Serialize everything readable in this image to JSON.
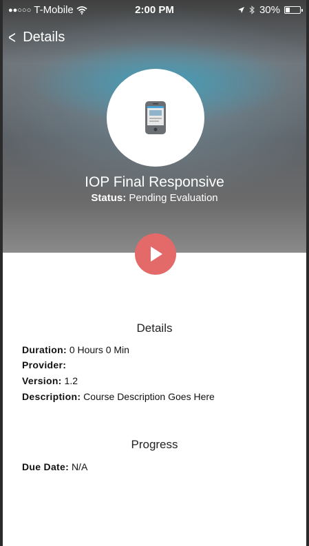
{
  "status_bar": {
    "signal": "●●○○○",
    "carrier": "T-Mobile",
    "time": "2:00 PM",
    "battery": "30%",
    "battery_level": 0.3
  },
  "nav": {
    "back_icon": "chevron-left",
    "title": "Details"
  },
  "course": {
    "icon": "mobile-phone-icon",
    "title": "IOP Final Responsive",
    "status_label": "Status:",
    "status_value": "Pending Evaluation"
  },
  "play": {
    "icon": "play-icon"
  },
  "details": {
    "heading": "Details",
    "duration_label": "Duration:",
    "duration_value": "0 Hours 0 Min",
    "provider_label": "Provider:",
    "provider_value": "",
    "version_label": "Version:",
    "version_value": "1.2",
    "description_label": "Description:",
    "description_value": "Course Description Goes Here"
  },
  "progress": {
    "heading": "Progress",
    "due_date_label": "Due Date:",
    "due_date_value": "N/A"
  },
  "colors": {
    "play_button": "#e46a6a",
    "hero_accent": "#3ca0be"
  }
}
